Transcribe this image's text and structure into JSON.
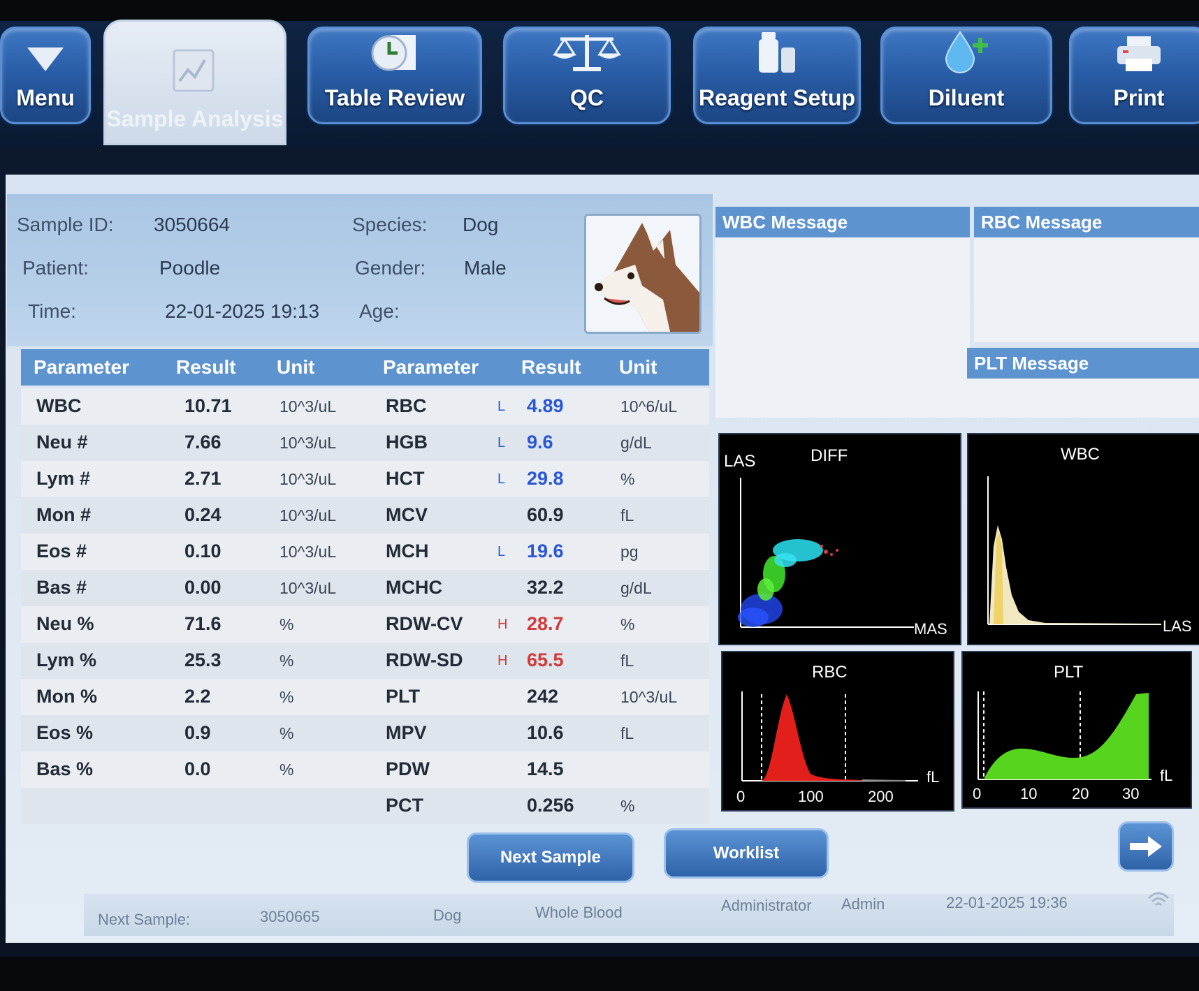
{
  "nav": {
    "menu": "Menu",
    "sample_analysis": "Sample Analysis",
    "table_review": "Table Review",
    "qc": "QC",
    "reagent_setup": "Reagent Setup",
    "diluent": "Diluent",
    "print": "Print"
  },
  "sample": {
    "id_label": "Sample ID:",
    "id_value": "3050664",
    "patient_label": "Patient:",
    "patient_value": "Poodle",
    "time_label": "Time:",
    "time_value": "22-01-2025 19:13",
    "species_label": "Species:",
    "species_value": "Dog",
    "gender_label": "Gender:",
    "gender_value": "Male",
    "age_label": "Age:",
    "age_value": ""
  },
  "table": {
    "headers": [
      "Parameter",
      "Result",
      "Unit",
      "Parameter",
      "Result",
      "Unit"
    ],
    "rows": [
      {
        "p1": "WBC",
        "r1": "10.71",
        "u1": "10^3/uL",
        "p2": "RBC",
        "f2": "L",
        "r2": "4.89",
        "u2": "10^6/uL"
      },
      {
        "p1": "Neu #",
        "r1": "7.66",
        "u1": "10^3/uL",
        "p2": "HGB",
        "f2": "L",
        "r2": "9.6",
        "u2": "g/dL"
      },
      {
        "p1": "Lym #",
        "r1": "2.71",
        "u1": "10^3/uL",
        "p2": "HCT",
        "f2": "L",
        "r2": "29.8",
        "u2": "%"
      },
      {
        "p1": "Mon #",
        "r1": "0.24",
        "u1": "10^3/uL",
        "p2": "MCV",
        "f2": "",
        "r2": "60.9",
        "u2": "fL"
      },
      {
        "p1": "Eos #",
        "r1": "0.10",
        "u1": "10^3/uL",
        "p2": "MCH",
        "f2": "L",
        "r2": "19.6",
        "u2": "pg"
      },
      {
        "p1": "Bas #",
        "r1": "0.00",
        "u1": "10^3/uL",
        "p2": "MCHC",
        "f2": "",
        "r2": "32.2",
        "u2": "g/dL"
      },
      {
        "p1": "Neu %",
        "r1": "71.6",
        "u1": "%",
        "p2": "RDW-CV",
        "f2": "H",
        "r2": "28.7",
        "u2": "%"
      },
      {
        "p1": "Lym %",
        "r1": "25.3",
        "u1": "%",
        "p2": "RDW-SD",
        "f2": "H",
        "r2": "65.5",
        "u2": "fL"
      },
      {
        "p1": "Mon %",
        "r1": "2.2",
        "u1": "%",
        "p2": "PLT",
        "f2": "",
        "r2": "242",
        "u2": "10^3/uL"
      },
      {
        "p1": "Eos %",
        "r1": "0.9",
        "u1": "%",
        "p2": "MPV",
        "f2": "",
        "r2": "10.6",
        "u2": "fL"
      },
      {
        "p1": "Bas %",
        "r1": "0.0",
        "u1": "%",
        "p2": "PDW",
        "f2": "",
        "r2": "14.5",
        "u2": ""
      },
      {
        "p1": "",
        "r1": "",
        "u1": "",
        "p2": "PCT",
        "f2": "",
        "r2": "0.256",
        "u2": "%"
      }
    ]
  },
  "messages": {
    "wbc": "WBC Message",
    "rbc": "RBC Message",
    "plt": "PLT Message"
  },
  "plots": {
    "diff": {
      "title": "DIFF",
      "y_label": "LAS",
      "x_label": "MAS"
    },
    "wbc": {
      "title": "WBC",
      "x_label": "LAS"
    },
    "rbc": {
      "title": "RBC",
      "unit": "fL",
      "ticks": [
        "0",
        "100",
        "200"
      ]
    },
    "plt": {
      "title": "PLT",
      "unit": "fL",
      "ticks": [
        "0",
        "10",
        "20",
        "30"
      ]
    }
  },
  "buttons": {
    "next_sample": "Next Sample",
    "worklist": "Worklist"
  },
  "status": {
    "next_label": "Next Sample:",
    "next_id": "3050665",
    "next_species": "Dog",
    "next_type": "Whole Blood",
    "role": "Administrator",
    "user": "Admin",
    "datetime": "22-01-2025 19:36"
  },
  "colors": {
    "low": "#2b56d4",
    "high": "#d13b3b",
    "header": "#5d93cf"
  }
}
